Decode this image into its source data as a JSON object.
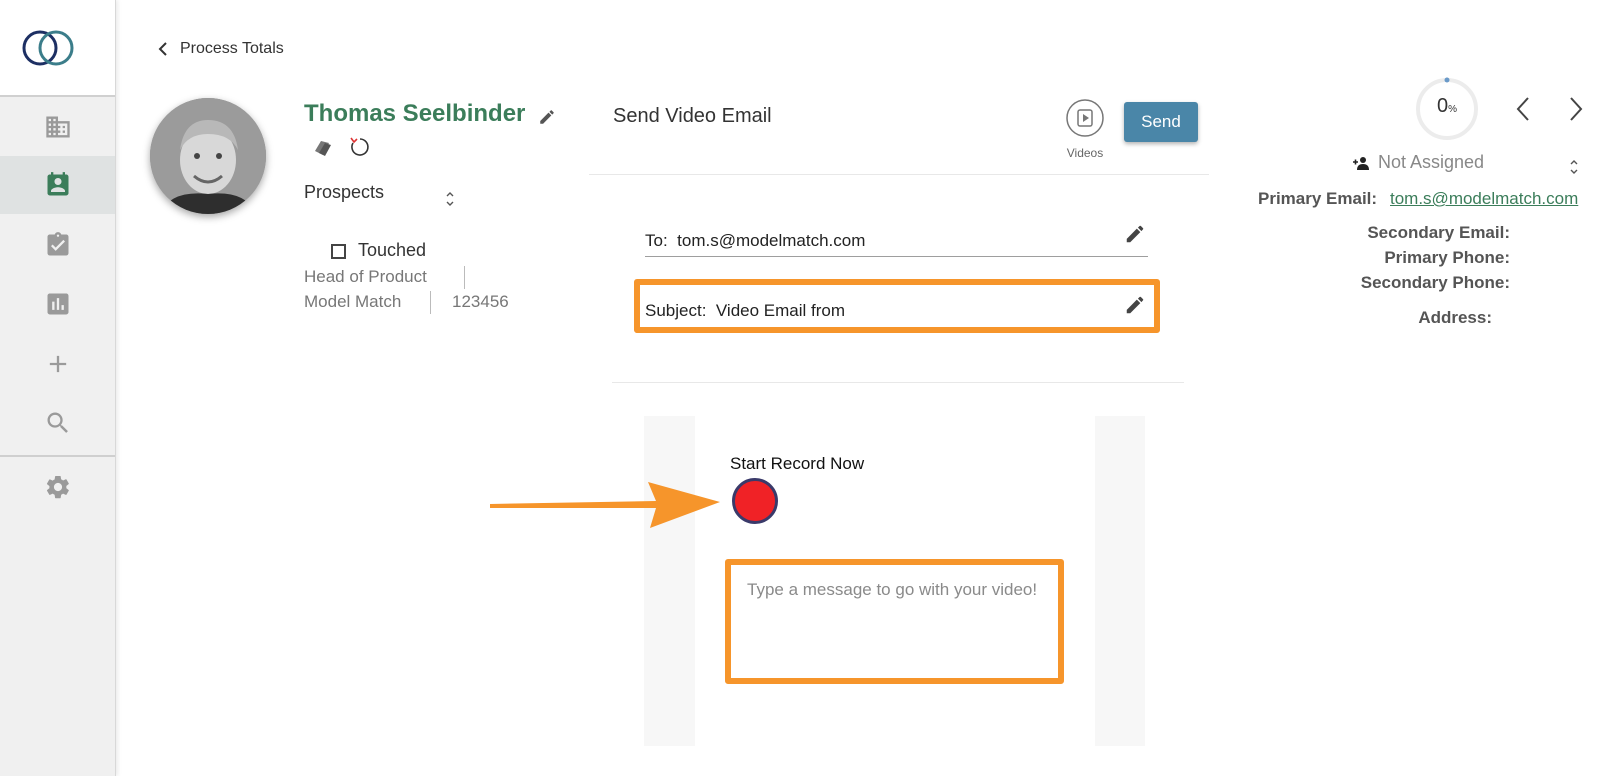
{
  "nav": {
    "back_label": "Process Totals"
  },
  "contact": {
    "name": "Thomas Seelbinder",
    "list_label": "Prospects",
    "touched_label": "Touched",
    "title": "Head of Product",
    "company": "Model Match",
    "number": "123456"
  },
  "email": {
    "panel_title": "Send Video Email",
    "videos_label": "Videos",
    "send_label": "Send",
    "to_label": "To:",
    "to_value": "tom.s@modelmatch.com",
    "subject_label": "Subject:",
    "subject_value": "Video Email from",
    "record_label": "Start Record Now",
    "message_placeholder": "Type a message to go with your video!"
  },
  "side": {
    "progress_value": "0",
    "progress_unit": "%",
    "assignee": "Not Assigned",
    "primary_email_label": "Primary Email:",
    "primary_email_value": "tom.s@modelmatch.com",
    "secondary_email_label": "Secondary Email:",
    "primary_phone_label": "Primary Phone:",
    "secondary_phone_label": "Secondary Phone:",
    "address_label": "Address:"
  },
  "colors": {
    "brand_green": "#3b7d5a",
    "send_blue": "#4a86a8",
    "highlight_orange": "#f6952b",
    "record_red": "#f02226"
  }
}
